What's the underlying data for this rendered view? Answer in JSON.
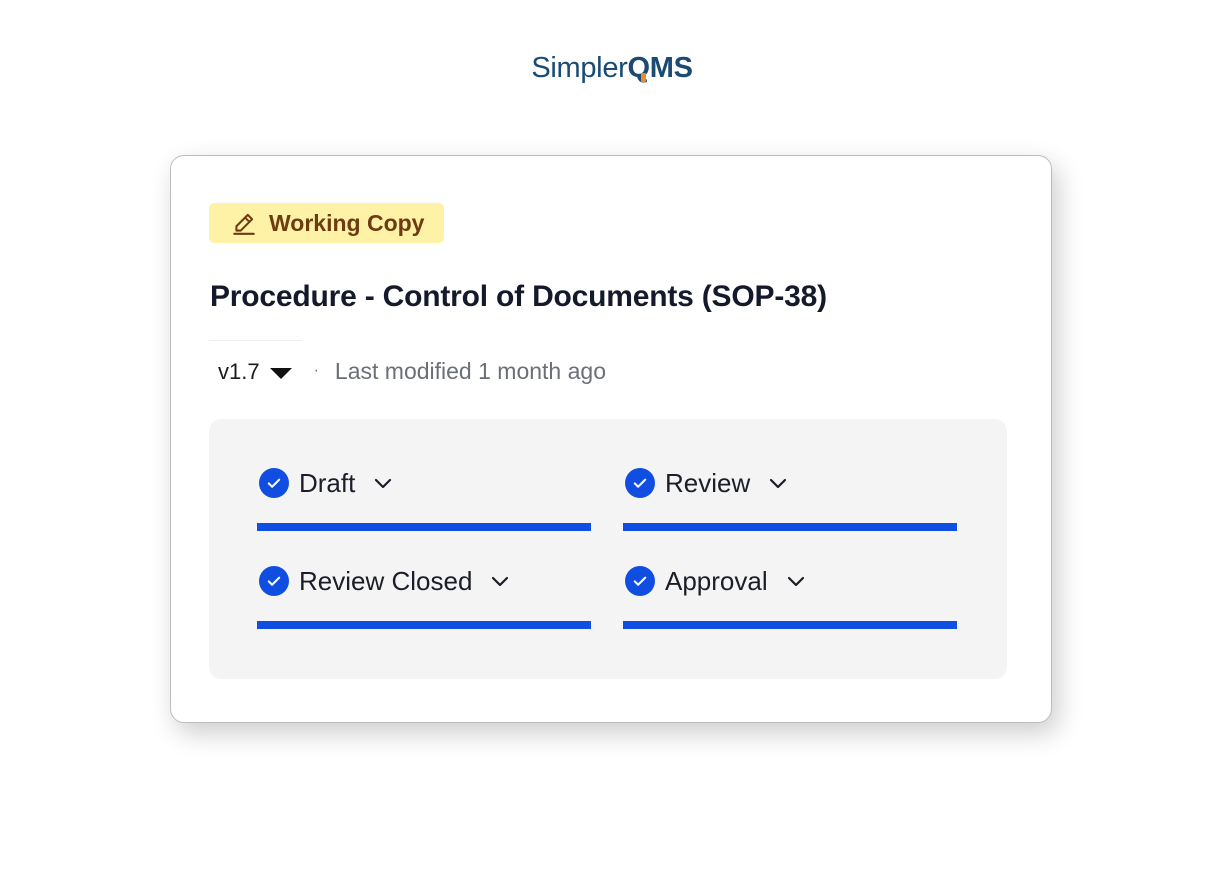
{
  "logo": {
    "light": "Simpler",
    "bold": "QMS"
  },
  "badge": {
    "label": "Working Copy",
    "icon": "pencil-icon",
    "background": "#fdf2a5",
    "text_color": "#6e3b12"
  },
  "document": {
    "title": "Procedure - Control of Documents (SOP-38)",
    "version": "v1.7",
    "separator": "·",
    "modified": "Last modified 1 month ago"
  },
  "stages": [
    {
      "label": "Draft",
      "status": "complete"
    },
    {
      "label": "Review",
      "status": "complete"
    },
    {
      "label": "Review Closed",
      "status": "complete"
    },
    {
      "label": "Approval",
      "status": "complete"
    }
  ],
  "colors": {
    "accent": "#0f4ee0",
    "brand": "#1b4a72",
    "brand_accent": "#f08a24",
    "panel": "#f4f4f5"
  }
}
